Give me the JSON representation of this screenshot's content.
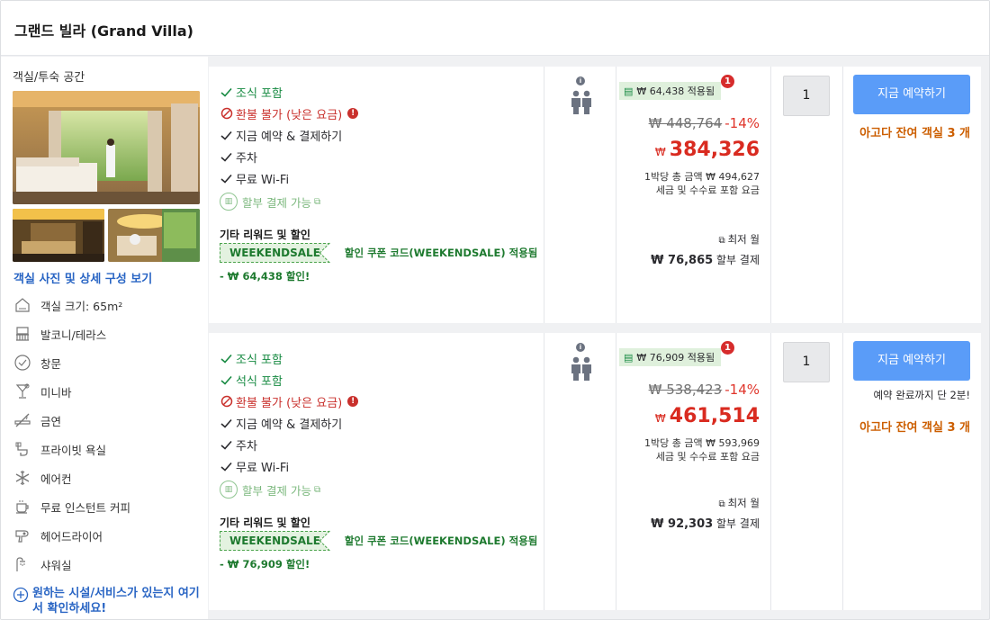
{
  "header": {
    "title": "그랜드 빌라 (Grand Villa)"
  },
  "room": {
    "section_title": "객실/투숙 공간",
    "photos_link": "객실 사진 및 상세 구성 보기",
    "amenities": [
      {
        "icon": "room-size-icon",
        "label": "객실 크기: 65m²"
      },
      {
        "icon": "balcony-icon",
        "label": "발코니/테라스"
      },
      {
        "icon": "window-icon",
        "label": "창문"
      },
      {
        "icon": "minibar-icon",
        "label": "미니바"
      },
      {
        "icon": "no-smoking-icon",
        "label": "금연"
      },
      {
        "icon": "private-bathroom-icon",
        "label": "프라이빗 욕실"
      },
      {
        "icon": "air-conditioner-icon",
        "label": "에어컨"
      },
      {
        "icon": "coffee-icon",
        "label": "무료 인스턴트 커피"
      },
      {
        "icon": "hair-dryer-icon",
        "label": "헤어드라이어"
      },
      {
        "icon": "shower-icon",
        "label": "샤워실"
      }
    ],
    "facilities_link": "원하는 시설/서비스가 있는지 여기서 확인하세요!"
  },
  "offers": [
    {
      "benefits": [
        {
          "type": "green",
          "text": "조식 포함"
        },
        {
          "type": "red",
          "text": "환불 불가 (낮은 요금)"
        },
        {
          "type": "dark",
          "text": "지금 예약 & 결제하기"
        },
        {
          "type": "dark",
          "text": "주차"
        },
        {
          "type": "dark",
          "text": "무료 Wi-Fi"
        }
      ],
      "installment": "할부 결제 가능",
      "rewards_title": "기타 리워드 및 할인",
      "coupon_code": "WEEKENDSALE",
      "coupon_text": "할인 쿠폰 코드(WEEKENDSALE) 적용됨",
      "discount_text": "- ₩ 64,438 할인!",
      "saved_label": "₩ 64,438 적용됨",
      "badge_count": "1",
      "original_price": "₩ 448,764",
      "percent_off": "-14%",
      "currency": "₩",
      "price": "384,326",
      "per_night": "1박당 총 금액 ₩ 494,627",
      "tax_note": "세금 및 수수료 포함 요금",
      "lowest_monthly": "최저 월",
      "monthly_amount": "₩ 76,865",
      "monthly_suffix": "할부 결제",
      "quantity": "1",
      "book_label": "지금 예약하기",
      "urgency_note": "",
      "rooms_left": "아고다 잔여 객실 3 개"
    },
    {
      "benefits": [
        {
          "type": "green",
          "text": "조식 포함"
        },
        {
          "type": "green",
          "text": "석식 포함"
        },
        {
          "type": "red",
          "text": "환불 불가 (낮은 요금)"
        },
        {
          "type": "dark",
          "text": "지금 예약 & 결제하기"
        },
        {
          "type": "dark",
          "text": "주차"
        },
        {
          "type": "dark",
          "text": "무료 Wi-Fi"
        }
      ],
      "installment": "할부 결제 가능",
      "rewards_title": "기타 리워드 및 할인",
      "coupon_code": "WEEKENDSALE",
      "coupon_text": "할인 쿠폰 코드(WEEKENDSALE) 적용됨",
      "discount_text": "- ₩ 76,909 할인!",
      "saved_label": "₩ 76,909 적용됨",
      "badge_count": "1",
      "original_price": "₩ 538,423",
      "percent_off": "-14%",
      "currency": "₩",
      "price": "461,514",
      "per_night": "1박당 총 금액 ₩ 593,969",
      "tax_note": "세금 및 수수료 포함 요금",
      "lowest_monthly": "최저 월",
      "monthly_amount": "₩ 92,303",
      "monthly_suffix": "할부 결제",
      "quantity": "1",
      "book_label": "지금 예약하기",
      "urgency_note": "예약 완료까지 단 2분!",
      "rooms_left": "아고다 잔여 객실 3 개"
    }
  ],
  "colors": {
    "accent_blue": "#5a9cf8",
    "link_blue": "#2965c4",
    "price_red": "#d92b20",
    "benefit_green": "#178a42",
    "urgency_orange": "#cc5e00"
  }
}
